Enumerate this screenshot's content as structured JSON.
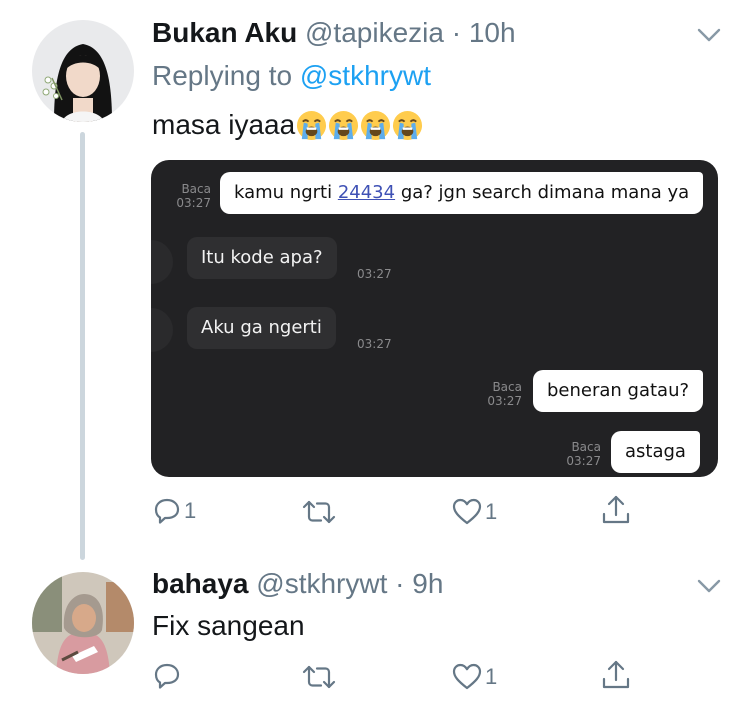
{
  "tweet1": {
    "name": "Bukan Aku",
    "handle": "@tapikezia",
    "separator": "·",
    "time": "10h",
    "replying_prefix": "Replying to ",
    "replying_to": "@stkhrywt",
    "text": "masa iyaaa",
    "emoji_icon": "loudly-crying-face",
    "emoji_count": 4,
    "chat": {
      "messages": [
        {
          "dir": "out",
          "text_before": "kamu ngrti ",
          "code": "24434",
          "text_after": " ga? jgn search dimana mana ya",
          "status": "Baca",
          "time": "03:27"
        },
        {
          "dir": "in",
          "text": "Itu kode apa?",
          "time": "03:27"
        },
        {
          "dir": "in",
          "text": "Aku ga ngerti",
          "time": "03:27"
        },
        {
          "dir": "out",
          "text": "beneran gatau?",
          "status": "Baca",
          "time": "03:27"
        },
        {
          "dir": "out",
          "text": "astaga",
          "status": "Baca",
          "time": "03:27"
        }
      ]
    },
    "actions": {
      "reply_count": "1",
      "like_count": "1"
    }
  },
  "tweet2": {
    "name": "bahaya",
    "handle": "@stkhrywt",
    "separator": "·",
    "time": "9h",
    "text": "Fix sangean",
    "actions": {
      "like_count": "1"
    }
  },
  "colors": {
    "link_blue": "#1da1f2",
    "secondary_gray": "#657786",
    "thread_line": "#ccd6dd",
    "chat_background": "#222224"
  }
}
